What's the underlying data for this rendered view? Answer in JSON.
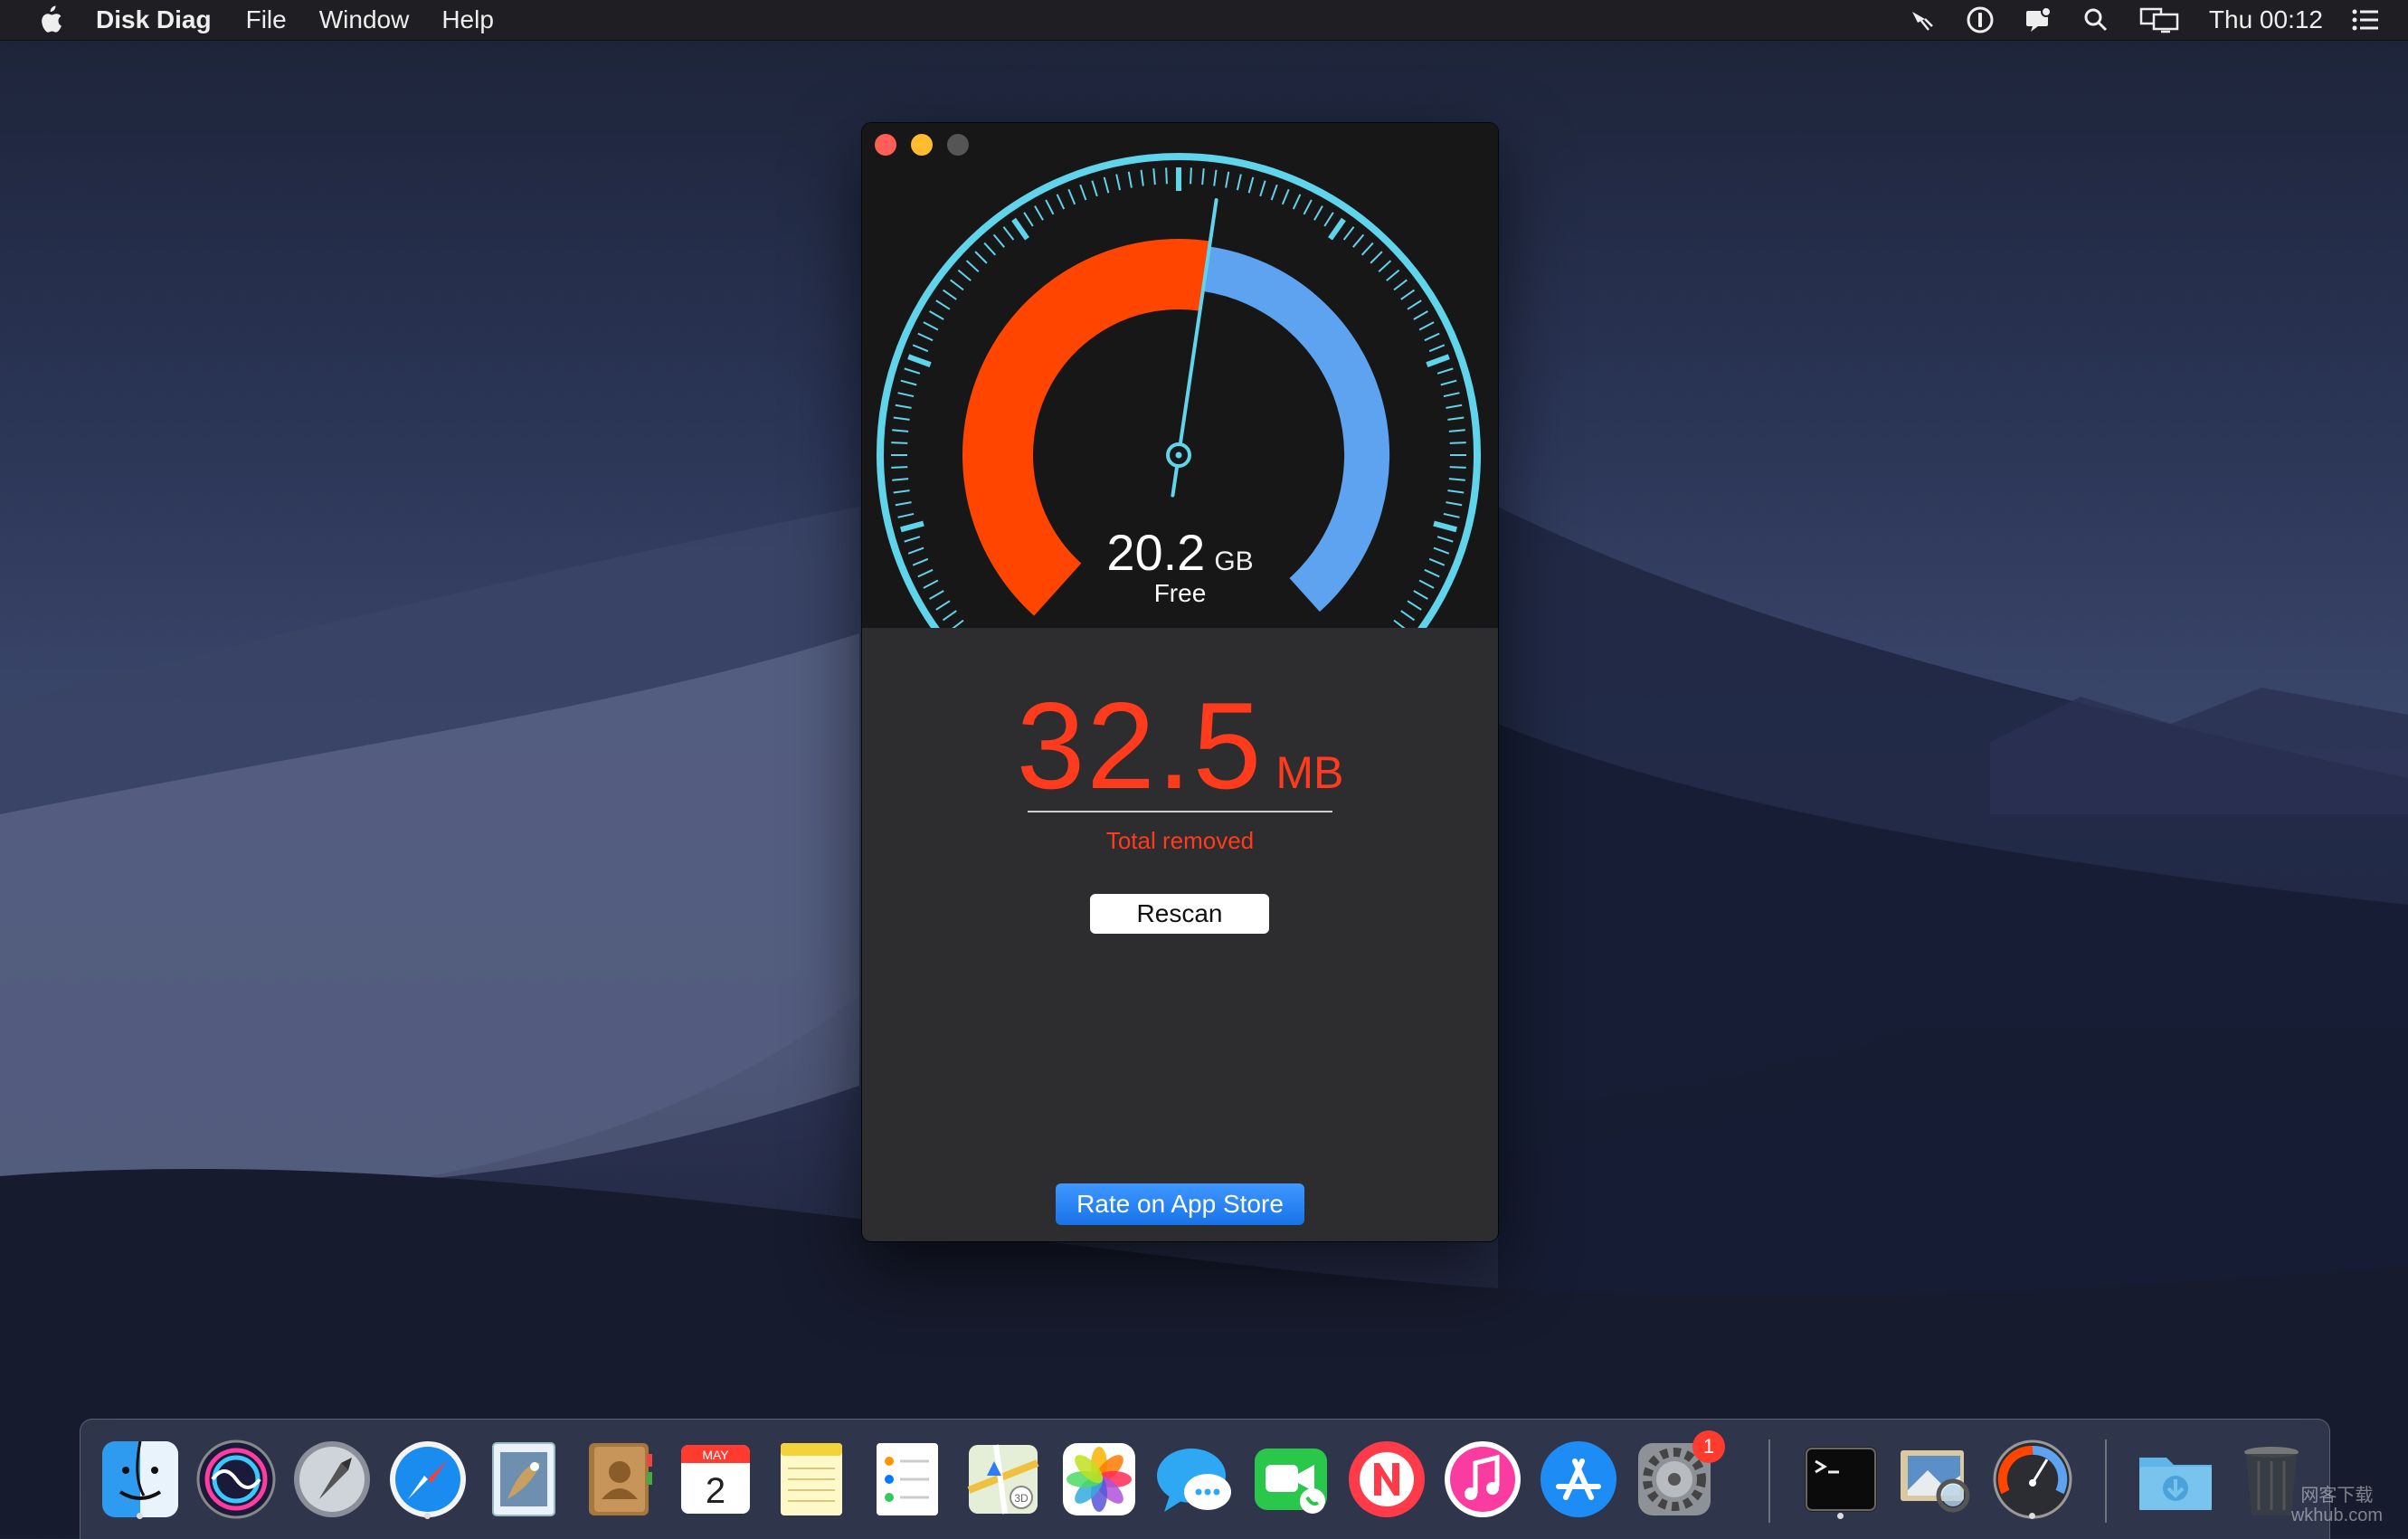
{
  "menubar": {
    "app_name": "Disk Diag",
    "menus": [
      "File",
      "Window",
      "Help"
    ],
    "clock": "Thu 00:12"
  },
  "gauge": {
    "free_value": "20.2",
    "free_unit": "GB",
    "free_label": "Free",
    "used_fraction": 0.53,
    "colors": {
      "used": "#ff4500",
      "free": "#5ea3f0",
      "scale": "#5fd4ea"
    }
  },
  "result": {
    "removed_value": "32.5",
    "removed_unit": "MB",
    "removed_label": "Total removed",
    "color": "#ff3b1d"
  },
  "buttons": {
    "rescan": "Rescan",
    "rate": "Rate on App Store"
  },
  "dock": {
    "items": [
      "finder-icon",
      "siri-icon",
      "launchpad-icon",
      "safari-icon",
      "mail-icon",
      "contacts-icon",
      "calendar-icon",
      "notes-icon",
      "reminders-icon",
      "maps-icon",
      "photos-icon",
      "messages-icon",
      "facetime-icon",
      "news-icon",
      "itunes-icon",
      "app-store-icon",
      "system-preferences-icon",
      "terminal-icon",
      "preview-icon",
      "disk-diag-icon",
      "downloads-folder-icon",
      "trash-icon"
    ],
    "calendar_month": "MAY",
    "calendar_day": "2",
    "system_preferences_badge": "1"
  },
  "watermark": {
    "line1": "网客下载",
    "line2": "wkhub.com"
  }
}
